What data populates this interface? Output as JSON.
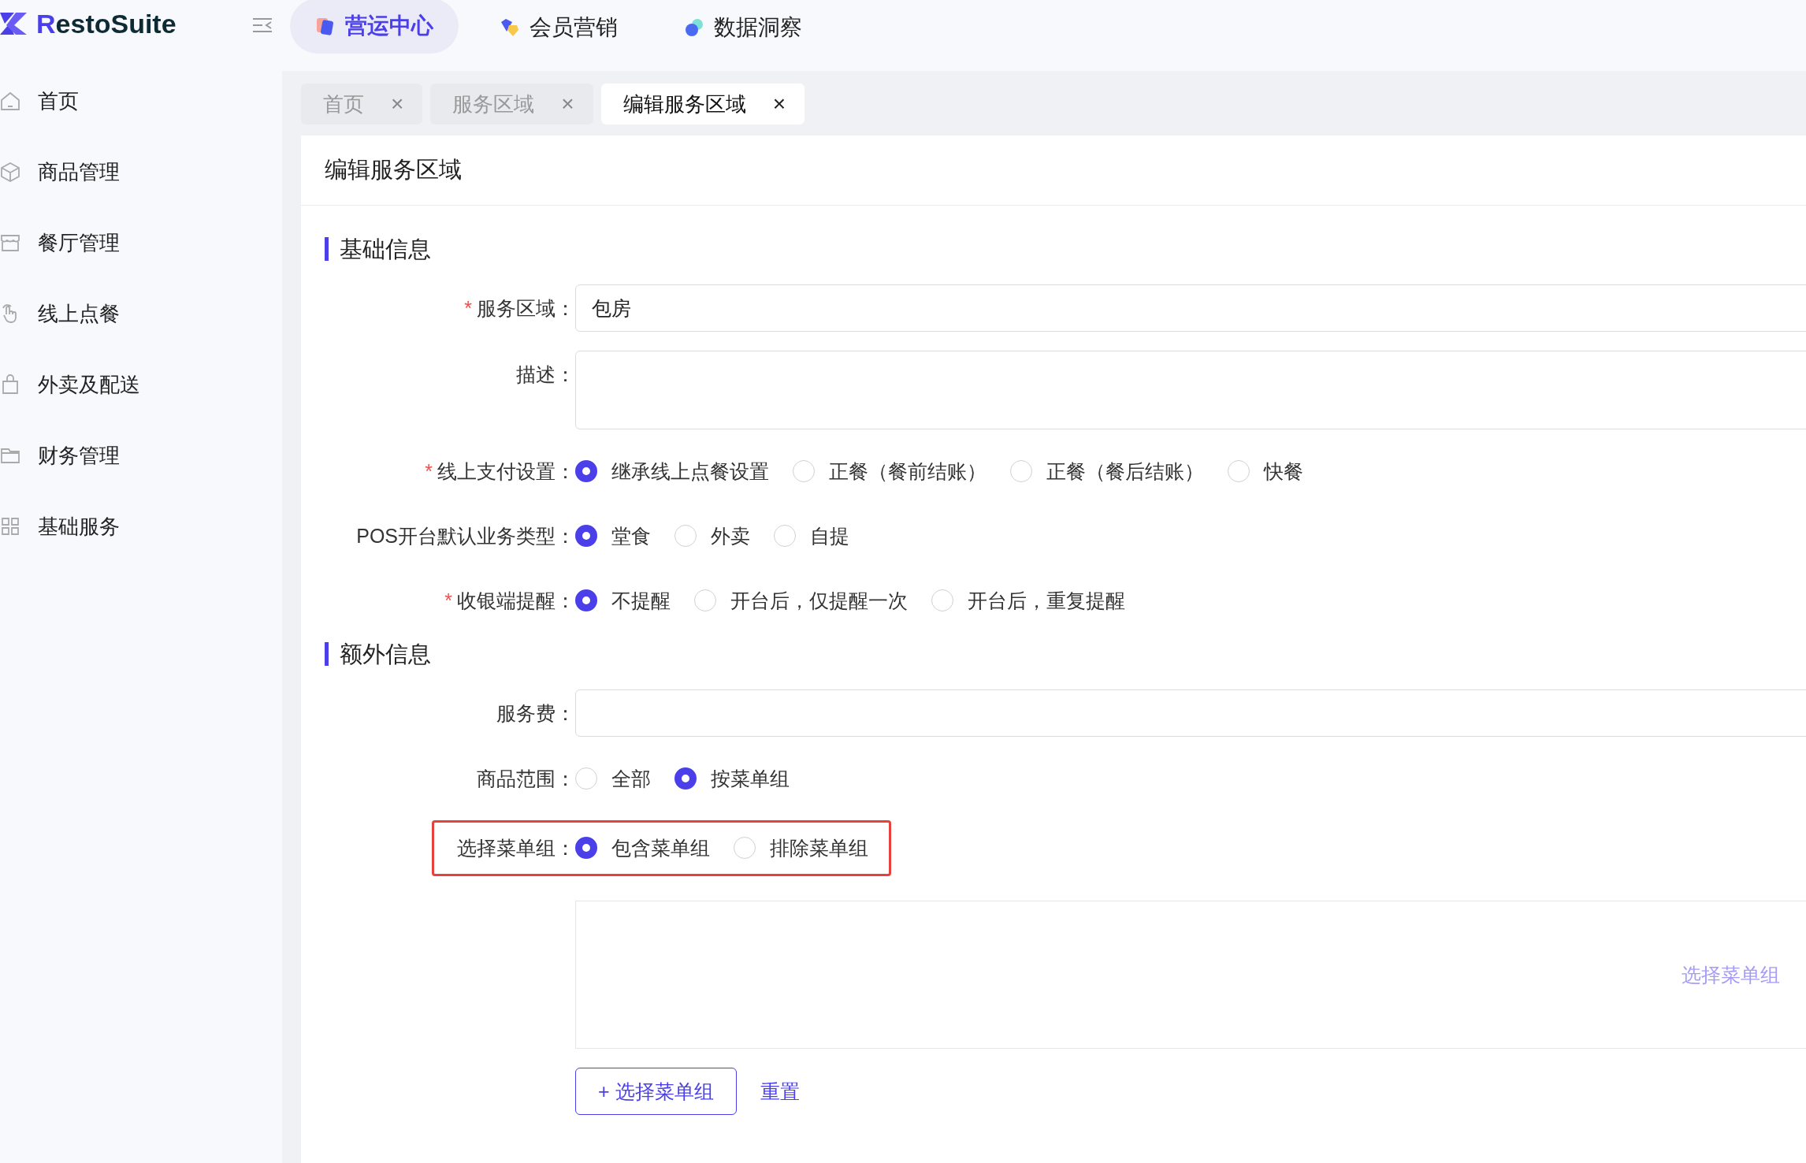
{
  "logo": {
    "text": "RestoSuite"
  },
  "top_nav": [
    {
      "label": "营运中心",
      "selected": true
    },
    {
      "label": "会员营销",
      "selected": false
    },
    {
      "label": "数据洞察",
      "selected": false
    }
  ],
  "sidebar": {
    "items": [
      {
        "label": "首页"
      },
      {
        "label": "商品管理"
      },
      {
        "label": "餐厅管理"
      },
      {
        "label": "线上点餐"
      },
      {
        "label": "外卖及配送"
      },
      {
        "label": "财务管理"
      },
      {
        "label": "基础服务"
      }
    ]
  },
  "page_tabs": [
    {
      "label": "首页",
      "selected": false,
      "close": "×"
    },
    {
      "label": "服务区域",
      "selected": false,
      "close": "×"
    },
    {
      "label": "编辑服务区域",
      "selected": true,
      "close": "×"
    }
  ],
  "card_title": "编辑服务区域",
  "sections": [
    {
      "title": "基础信息",
      "rows": [
        {
          "kind": "input",
          "label": "服务区域",
          "required": true,
          "value": "包房"
        },
        {
          "kind": "textarea",
          "label": "描述",
          "required": false
        },
        {
          "kind": "radio",
          "label": "线上支付设置",
          "required": true,
          "options": [
            {
              "label": "继承线上点餐设置",
              "selected": true
            },
            {
              "label": "正餐（餐前结账）",
              "selected": false
            },
            {
              "label": "正餐（餐后结账）",
              "selected": false
            },
            {
              "label": "快餐",
              "selected": false
            }
          ]
        },
        {
          "kind": "radio",
          "label": "POS开台默认业务类型",
          "required": false,
          "options": [
            {
              "label": "堂食",
              "selected": true
            },
            {
              "label": "外卖",
              "selected": false
            },
            {
              "label": "自提",
              "selected": false
            }
          ]
        },
        {
          "kind": "radio",
          "label": "收银端提醒",
          "required": true,
          "options": [
            {
              "label": "不提醒",
              "selected": true
            },
            {
              "label": "开台后，仅提醒一次",
              "selected": false
            },
            {
              "label": "开台后，重复提醒",
              "selected": false
            }
          ]
        }
      ]
    },
    {
      "title": "额外信息",
      "rows": [
        {
          "kind": "input",
          "label": "服务费",
          "required": false
        },
        {
          "kind": "radio",
          "label": "商品范围",
          "required": false,
          "options": [
            {
              "label": "全部",
              "selected": false
            },
            {
              "label": "按菜单组",
              "selected": true
            }
          ]
        },
        {
          "kind": "radio",
          "label": "选择菜单组",
          "required": false,
          "highlighted": true,
          "options": [
            {
              "label": "包含菜单组",
              "selected": true
            },
            {
              "label": "排除菜单组",
              "selected": false
            }
          ]
        },
        {
          "kind": "panel",
          "empty_text": "选择菜单组"
        },
        {
          "kind": "actions",
          "primary": "+ 选择菜单组",
          "secondary": "重置"
        }
      ]
    }
  ],
  "colon": "：",
  "required_mark": "*"
}
